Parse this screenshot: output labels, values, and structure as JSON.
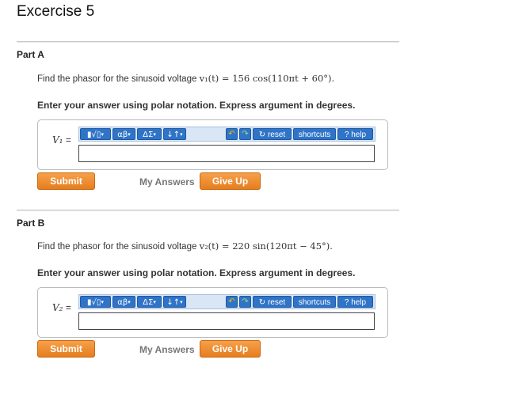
{
  "page": {
    "title": "Excercise 5"
  },
  "toolbar": {
    "templates_label": "▮√▯",
    "greek_label": "αβ",
    "symbols_label": "ΔΣ",
    "arrows_label": "↓↑",
    "undo_icon": "↶",
    "redo_icon": "↷",
    "reset_label": "↻ reset",
    "shortcuts_label": "shortcuts",
    "help_label": "? help"
  },
  "common": {
    "submit_label": "Submit",
    "my_answers_label": "My Answers",
    "give_up_label": "Give Up",
    "instruction": "Enter your answer using polar notation. Express argument in degrees."
  },
  "parts": [
    {
      "title": "Part A",
      "question_prefix": "Find the phasor for the sinusoid voltage ",
      "question_math": "v₁(t) = 156 cos(110πt + 60°).",
      "var_name": "V₁",
      "var_eq": " =",
      "answer_value": ""
    },
    {
      "title": "Part B",
      "question_prefix": "Find the phasor for the sinusoid voltage ",
      "question_math": "v₂(t) = 220 sin(120πt − 45°).",
      "var_name": "V₂",
      "var_eq": " =",
      "answer_value": ""
    }
  ]
}
